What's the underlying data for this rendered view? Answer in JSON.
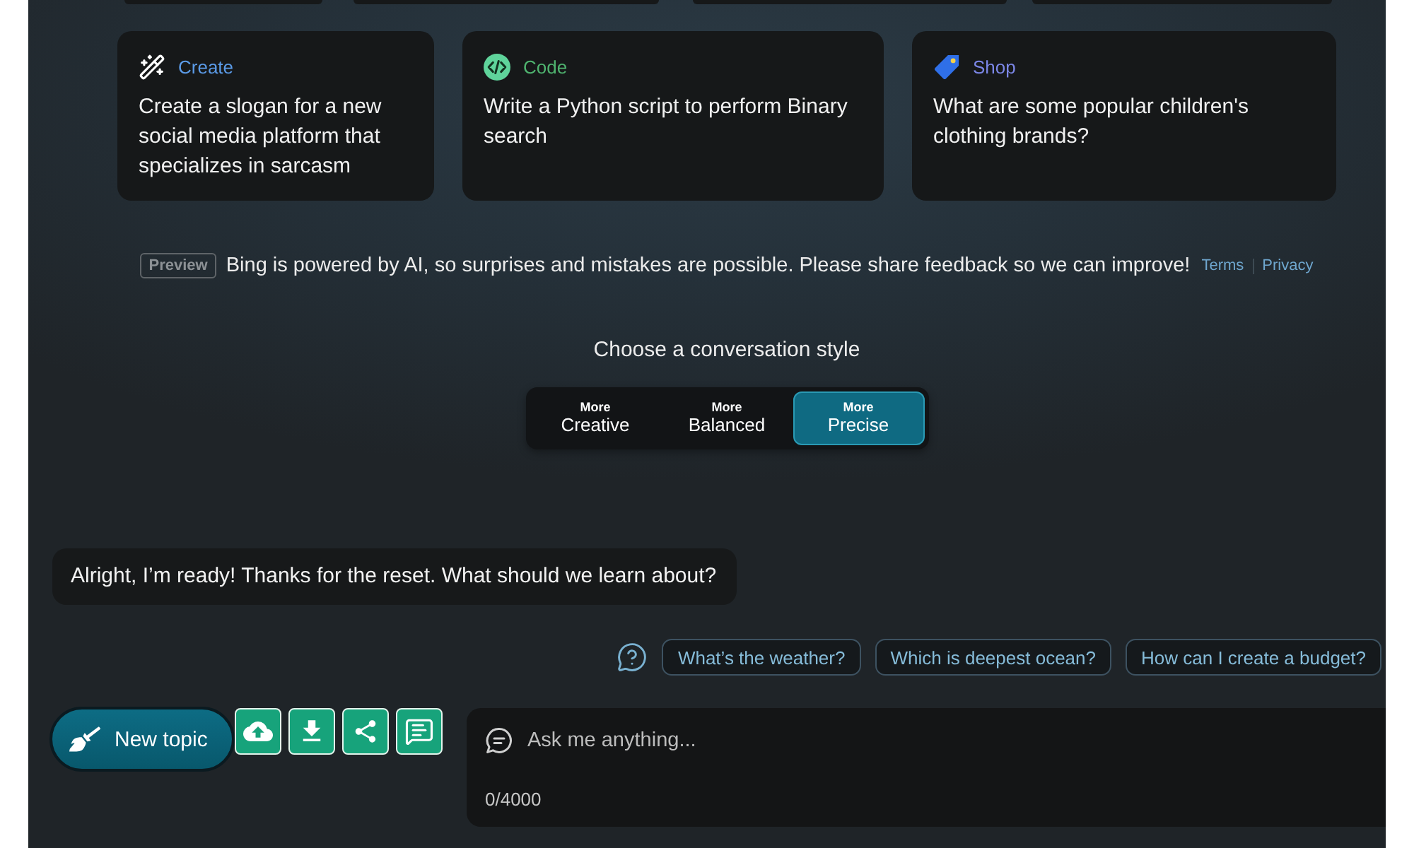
{
  "suggestion_cards": [
    {
      "kind": "create",
      "category": "Create",
      "color": "#5b9be8",
      "text": "Create a slogan for a new social media platform that specializes in sarcasm"
    },
    {
      "kind": "code",
      "category": "Code",
      "color": "#4fb36f",
      "text": "Write a Python script to perform Binary search"
    },
    {
      "kind": "shop",
      "category": "Shop",
      "color": "#7b86e6",
      "text": "What are some popular children's clothing brands?"
    }
  ],
  "disclaimer": {
    "badge": "Preview",
    "text": "Bing is powered by AI, so surprises and mistakes are possible. Please share feedback so we can improve!",
    "links": [
      "Terms",
      "Privacy"
    ]
  },
  "conversation_style": {
    "title": "Choose a conversation style",
    "options": [
      {
        "prefix": "More",
        "label": "Creative",
        "selected": false
      },
      {
        "prefix": "More",
        "label": "Balanced",
        "selected": false
      },
      {
        "prefix": "More",
        "label": "Precise",
        "selected": true
      }
    ]
  },
  "messages": [
    {
      "text": "Alright, I’m ready! Thanks for the reset. What should we learn about?"
    }
  ],
  "suggested_replies": [
    "What’s the weather?",
    "Which is deepest ocean?",
    "How can I create a budget?"
  ],
  "toolbar": {
    "new_topic": "New topic",
    "actions": [
      {
        "kind": "upload"
      },
      {
        "kind": "download"
      },
      {
        "kind": "share"
      },
      {
        "kind": "chat"
      }
    ]
  },
  "composer": {
    "placeholder": "Ask me anything...",
    "counter": "0/4000"
  }
}
